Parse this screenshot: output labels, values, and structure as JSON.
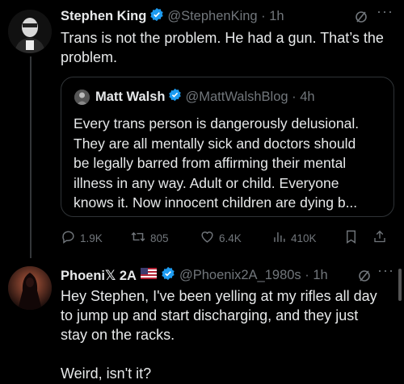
{
  "colors": {
    "background": "#000000",
    "text": "#e7e9ea",
    "muted": "#71767b",
    "verified": "#1d9bf0",
    "border": "#2f3336"
  },
  "tweet1": {
    "name": "Stephen King",
    "handle": "@StephenKing · 1h",
    "text": "Trans is not the problem. He had a gun. That’s the\nproblem.",
    "quote": {
      "name": "Matt Walsh",
      "handle": "@MattWalshBlog · 4h",
      "text": "Every trans person is dangerously delusional.\nThey are all mentally sick and doctors should\nbe legally barred from affirming their mental\nillness in any way. Adult or child. Everyone\nknows it. Now innocent children are dying b..."
    },
    "actions": {
      "replies": "1.9K",
      "retweets": "805",
      "likes": "6.4K",
      "views": "410K"
    },
    "icons": [
      "grok-icon",
      "more-icon",
      "reply-icon",
      "retweet-icon",
      "like-icon",
      "views-icon",
      "bookmark-icon",
      "share-icon"
    ]
  },
  "tweet2": {
    "name": "Phoeni𝕏 2A",
    "flag": "🇺🇸",
    "handle": "@Phoenix2A_1980s · 1h",
    "text": "Hey Stephen, I've been yelling at my rifles all day\nto jump up and start discharging, and they just\nstay on the racks.\n\nWeird, isn't it?"
  }
}
